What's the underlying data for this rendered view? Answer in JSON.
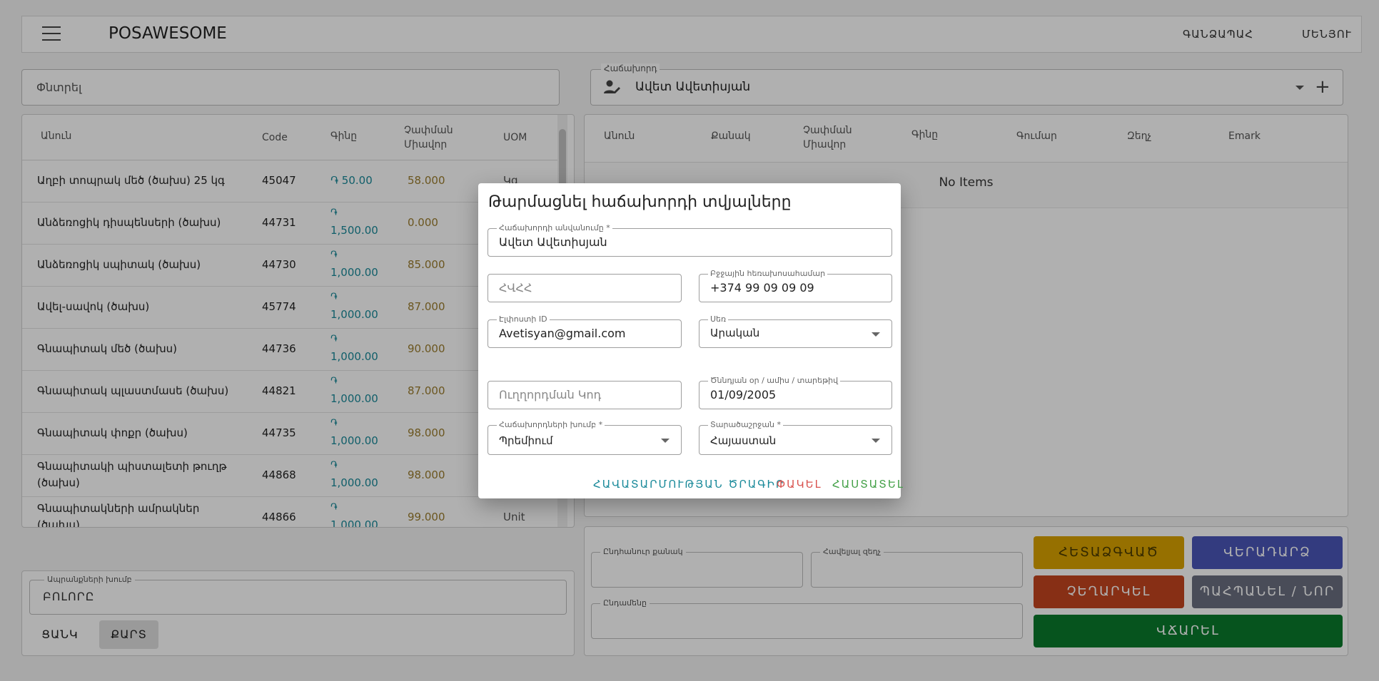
{
  "app": {
    "brand": "POSAWESOME",
    "nav": {
      "payments": "ԳԱՆՁԱՊԱՀ",
      "menu": "ՄԵՆՅՈՒ"
    }
  },
  "search": {
    "placeholder": "Փնտրել"
  },
  "items_table": {
    "headers": {
      "name": "Անուն",
      "code": "Code",
      "rate": "Գինը",
      "uom_qty_1": "Չափման",
      "uom_qty_2": "Միավոր",
      "uom": "UOM"
    },
    "rows": [
      {
        "name": "Աղբի տոպրակ մեծ (ծախս) 25 կգ",
        "name2": "",
        "code": "45047",
        "price": "֏ 50.00",
        "price2": "",
        "qty": "58.000",
        "uom": "Կգ"
      },
      {
        "name": "Անձեռոցիկ դիսպենսերի (ծախս)",
        "name2": "",
        "code": "44731",
        "price": "֏",
        "price2": "1,500.00",
        "qty": "0.000",
        "uom": ""
      },
      {
        "name": "Անձեռոցիկ սպիտակ (ծախս)",
        "name2": "",
        "code": "44730",
        "price": "֏",
        "price2": "1,000.00",
        "qty": "85.000",
        "uom": ""
      },
      {
        "name": "Ավել-սավոկ (ծախս)",
        "name2": "",
        "code": "45774",
        "price": "֏",
        "price2": "1,000.00",
        "qty": "87.000",
        "uom": ""
      },
      {
        "name": "Գնապիտակ մեծ (ծախս)",
        "name2": "",
        "code": "44736",
        "price": "֏",
        "price2": "1,000.00",
        "qty": "90.000",
        "uom": ""
      },
      {
        "name": "Գնապիտակ պլաստմասե (ծախս)",
        "name2": "",
        "code": "44821",
        "price": "֏",
        "price2": "1,000.00",
        "qty": "87.000",
        "uom": ""
      },
      {
        "name": "Գնապիտակ փոքր (ծախս)",
        "name2": "",
        "code": "44735",
        "price": "֏",
        "price2": "1,000.00",
        "qty": "98.000",
        "uom": ""
      },
      {
        "name": "Գնապիտակի պիստալետի թուղթ",
        "name2": "(ծախս)",
        "code": "44868",
        "price": "֏",
        "price2": "1,000.00",
        "qty": "98.000",
        "uom": ""
      },
      {
        "name": "Գնապիտակների ամրակներ",
        "name2": "(ծախս)",
        "code": "44866",
        "price": "֏",
        "price2": "1,000.00",
        "qty": "99.000",
        "uom": "Unit"
      }
    ]
  },
  "item_group": {
    "label": "Ապրանքների խումբ",
    "value": "ԲՈԼՈՐԸ"
  },
  "view_toggle": {
    "list": "ՑԱՆԿ",
    "card": "ՔԱՐՏ"
  },
  "customer": {
    "label": "Հաճախորդ",
    "value": "Ավետ Ավետիսյան"
  },
  "cart_table": {
    "headers": {
      "name": "Անուն",
      "qty": "Քանակ",
      "uom_1": "Չափման",
      "uom_2": "Միավոր",
      "rate": "Գինը",
      "amount": "Գումար",
      "discount": "Զեղչ",
      "emark": "Emark"
    },
    "empty": "No Items"
  },
  "totals": {
    "total_qty_label": "Ընդհանուր քանակ",
    "additional_discount_label": "Հավելյալ զեղչ",
    "grand_total_label": "Ընդամենը"
  },
  "actions": {
    "hold": "ՀԵՏԱՁԳՎԱԾ",
    "return": "ՎԵՐԱԴԱՐՁ",
    "cancel": "ՉԵՂԱՐԿԵԼ",
    "save_new": "ՊԱՀՊԱՆԵԼ / ՆՈՐ",
    "pay": "ՎՃԱՐԵԼ"
  },
  "colors": {
    "hold": "#d9a300",
    "return": "#4a56b8",
    "cancel": "#c4451f",
    "save_new": "#6b6f80",
    "pay": "#0a7a2c",
    "accent_teal": "#1a8a9a",
    "cancel_text": "#d9534f",
    "submit_text": "#43a047"
  },
  "dialog": {
    "title": "Թարմացնել հաճախորդի տվյալները",
    "customer_name_label": "Հաճախորդի անվանումը *",
    "customer_name_value": "Ավետ Ավետիսյան",
    "tax_id_placeholder": "ՀՎՀՀ",
    "mobile_label": "Բջջային հեռախոսահամար",
    "mobile_value": "+374 99 09 09 09",
    "email_label": "Էլփոստի ID",
    "email_value": "Avetisyan@gmail.com",
    "gender_label": "Սեռ",
    "gender_value": "Արական",
    "referral_placeholder": "Ուղղորդման Կոդ",
    "birthday_label": "Ծննդյան օր / ամիս / տարեթիվ",
    "birthday_value": "01/09/2005",
    "group_label": "Հաճախորդների խումբ *",
    "group_value": "Պրեմիում",
    "territory_label": "Տարածաշրջան *",
    "territory_value": "Հայաստան",
    "btn_loyalty": "ՀԱՎԱՏԱՐՄՈՒԹՅԱՆ ԾՐԱԳԻՐ",
    "btn_close": "ՓԱԿԵԼ",
    "btn_submit": "ՀԱՍՏԱՏԵԼ"
  }
}
